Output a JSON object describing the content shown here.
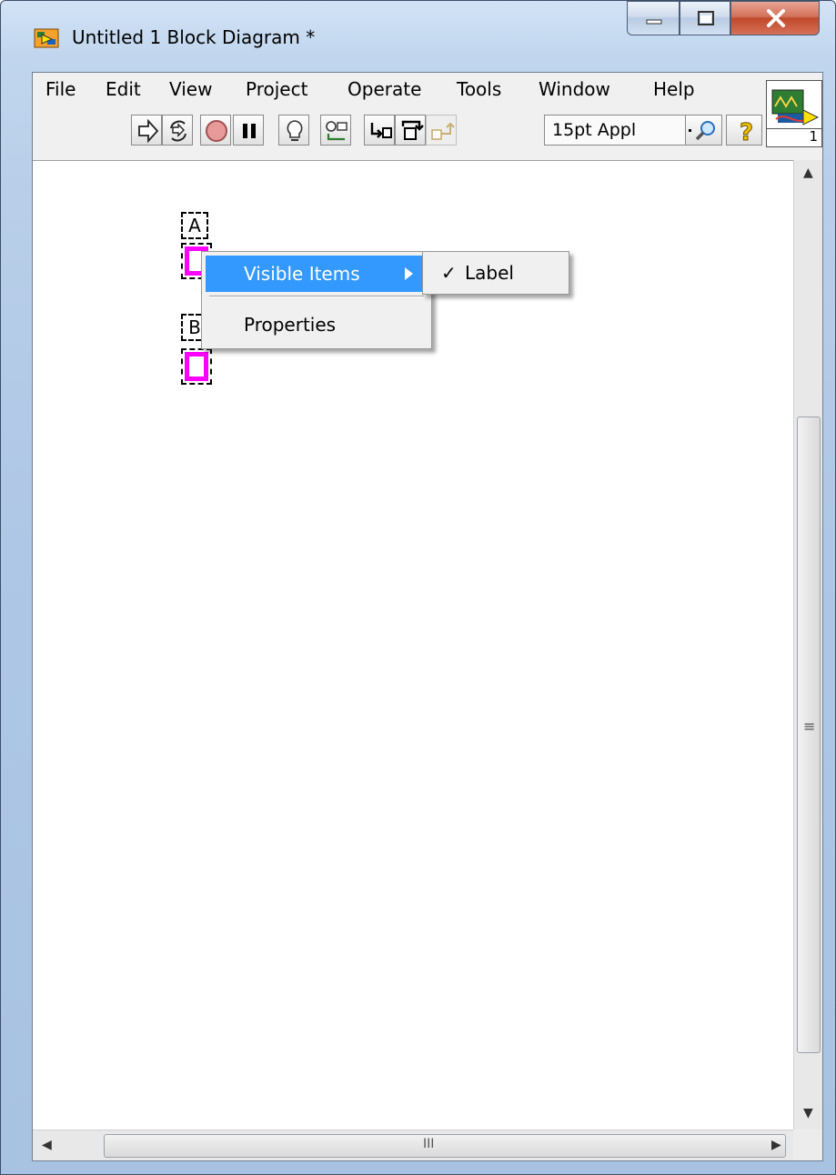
{
  "window": {
    "title": "Untitled 1 Block Diagram *",
    "icon": "labview-block-diagram-icon"
  },
  "menubar": {
    "items": [
      "File",
      "Edit",
      "View",
      "Project",
      "Operate",
      "Tools",
      "Window",
      "Help"
    ]
  },
  "toolbar": {
    "buttons": [
      "run-arrow-icon",
      "run-continuously-icon",
      "abort-icon",
      "pause-icon",
      "highlight-execution-icon",
      "retain-wire-values-icon",
      "step-into-icon",
      "step-over-icon",
      "step-out-icon"
    ],
    "font_select": "15pt Appl",
    "search_icon": "search-icon",
    "help_icon": "context-help-icon",
    "vi_icon_number": "1"
  },
  "diagram": {
    "controls": [
      {
        "label": "A"
      },
      {
        "label": "B"
      }
    ]
  },
  "context_menu": {
    "items": [
      "Visible Items",
      "Properties"
    ],
    "submenu": {
      "check_mark": "✓",
      "items": [
        "Label"
      ]
    }
  },
  "scrollbars": {
    "hscroll_grip": "III",
    "vscroll_grip": "≡"
  },
  "colors": {
    "highlight": "#3399ff",
    "control_border": "#ff00ff"
  }
}
